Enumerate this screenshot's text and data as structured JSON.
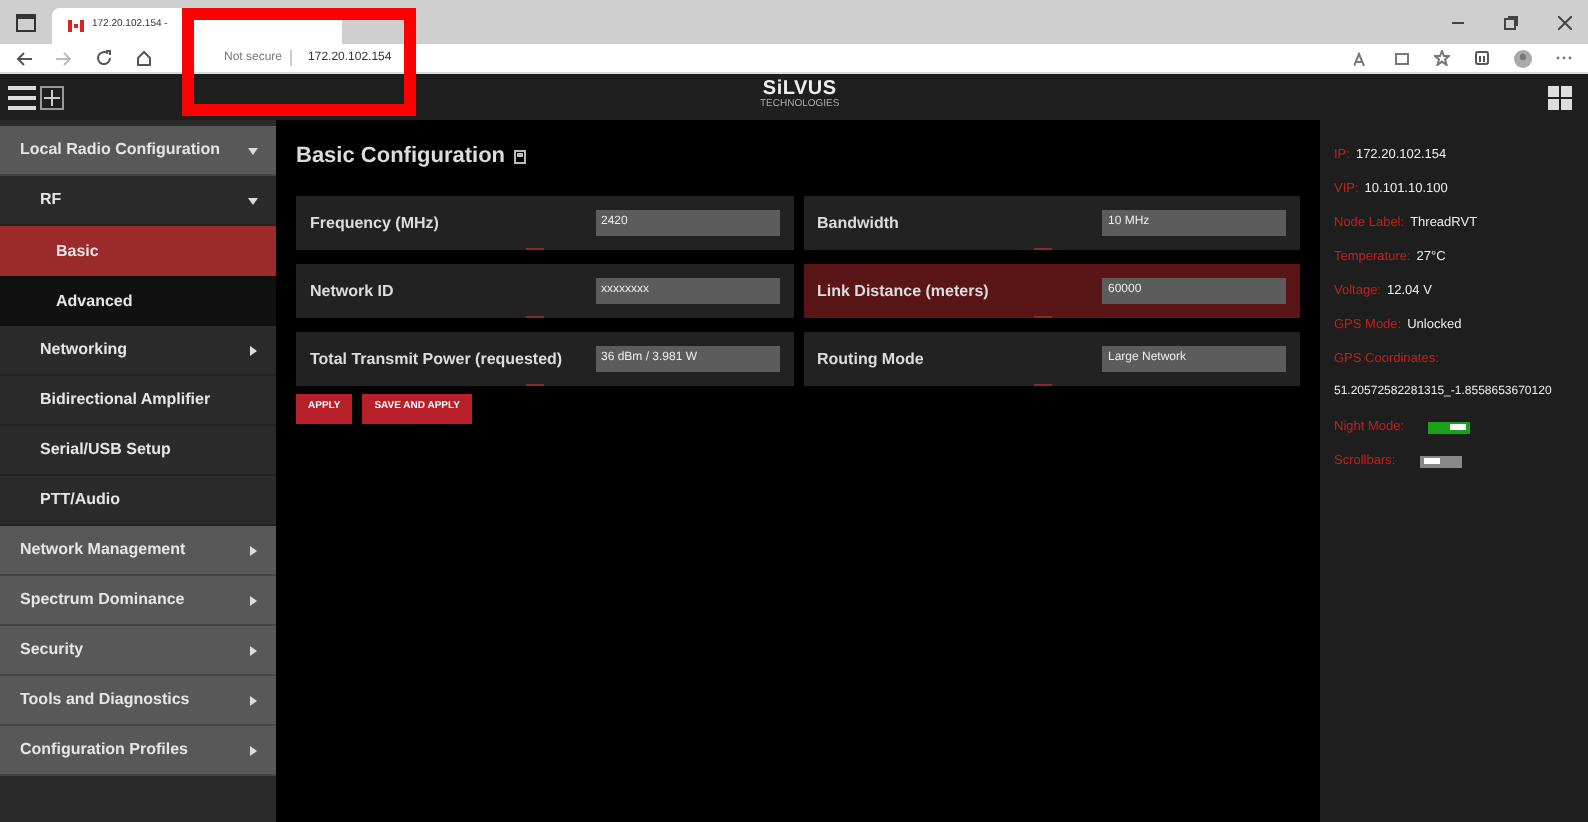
{
  "browser": {
    "tab_title": "172.20.102.154 -",
    "security": "Not secure",
    "address": "172.20.102.154"
  },
  "app": {
    "logo": "SiLVUS",
    "logo_sub": "TECHNOLOGIES"
  },
  "sidebar": {
    "items": [
      {
        "label": "Local Radio Configuration",
        "selected": false,
        "expanded": true,
        "children": [
          {
            "label": "RF",
            "selected": false,
            "expanded": true,
            "children": [
              {
                "label": "Basic",
                "selected": true
              },
              {
                "label": "Advanced",
                "selected": false
              }
            ]
          },
          {
            "label": "Networking",
            "selected": false,
            "expanded": false
          },
          {
            "label": "Bidirectional Amplifier",
            "selected": false
          },
          {
            "label": "Serial/USB Setup",
            "selected": false
          },
          {
            "label": "PTT/Audio",
            "selected": false
          }
        ]
      },
      {
        "label": "Network Management",
        "selected": false,
        "expanded": false
      },
      {
        "label": "Spectrum Dominance",
        "selected": false,
        "expanded": false
      },
      {
        "label": "Security",
        "selected": false,
        "expanded": false
      },
      {
        "label": "Tools and Diagnostics",
        "selected": false,
        "expanded": false
      },
      {
        "label": "Configuration Profiles",
        "selected": false,
        "expanded": false
      }
    ]
  },
  "main": {
    "title": "Basic Configuration",
    "fields": [
      {
        "label": "Frequency (MHz)",
        "value": "2420",
        "highlighted": false
      },
      {
        "label": "Bandwidth",
        "value": "10 MHz",
        "highlighted": false
      },
      {
        "label": "Network ID",
        "value": "xxxxxxxx",
        "highlighted": false
      },
      {
        "label": "Link Distance (meters)",
        "value": "60000",
        "highlighted": true
      },
      {
        "label": "Total Transmit Power (requested)",
        "value": "36 dBm / 3.981 W",
        "highlighted": false
      },
      {
        "label": "Routing Mode",
        "value": "Large Network",
        "highlighted": false
      }
    ],
    "buttons": [
      "APPLY",
      "SAVE AND APPLY"
    ]
  },
  "status_panel": {
    "items": [
      {
        "kind": "text",
        "label": "IP:",
        "value": "172.20.102.154"
      },
      {
        "kind": "text",
        "label": "VIP:",
        "value": "10.101.10.100"
      },
      {
        "kind": "text",
        "label": "Node Label:",
        "value": "ThreadRVT"
      },
      {
        "kind": "text",
        "label": "Temperature:",
        "value": "27°C"
      },
      {
        "kind": "text",
        "label": "Voltage:",
        "value": "12.04 V"
      },
      {
        "kind": "text",
        "label": "GPS Mode:",
        "value": "Unlocked"
      },
      {
        "kind": "block",
        "label": "GPS Coordinates:",
        "value": "51.20572582281315_-1.8558653670120"
      },
      {
        "kind": "toggle",
        "label": "Night Mode:",
        "on": true
      },
      {
        "kind": "toggle",
        "label": "Scrollbars:",
        "on": false
      }
    ]
  }
}
